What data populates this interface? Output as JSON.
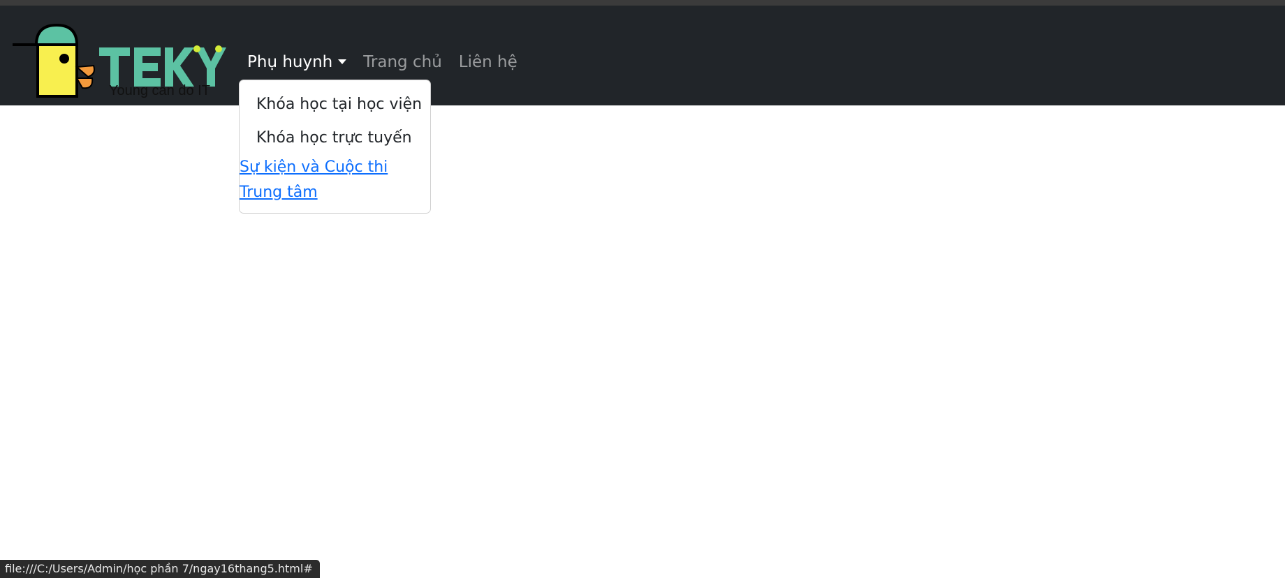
{
  "logo": {
    "brand": "TEKY",
    "tagline": "Young can do IT",
    "colors": {
      "teal": "#5cc2a3",
      "yellow": "#f8ef4f",
      "orange": "#f39a3c",
      "lime": "#d4ec38",
      "outline": "#000000"
    }
  },
  "navbar": {
    "background": "#212529",
    "items": [
      {
        "label": "Phụ huynh",
        "active": true,
        "has_caret": true
      },
      {
        "label": "Trang chủ",
        "active": false
      },
      {
        "label": "Liên hệ",
        "active": false
      }
    ]
  },
  "dropdown": {
    "items": [
      {
        "label": "Khóa học tại học viện"
      },
      {
        "label": "Khóa học trực tuyến"
      }
    ],
    "links": [
      {
        "label": "Sự kiện và Cuộc thi"
      },
      {
        "label": "Trung tâm"
      }
    ],
    "link_color": "#0d6efd"
  },
  "status_bar": {
    "url": "file:///C:/Users/Admin/học phần 7/ngay16thang5.html#"
  }
}
